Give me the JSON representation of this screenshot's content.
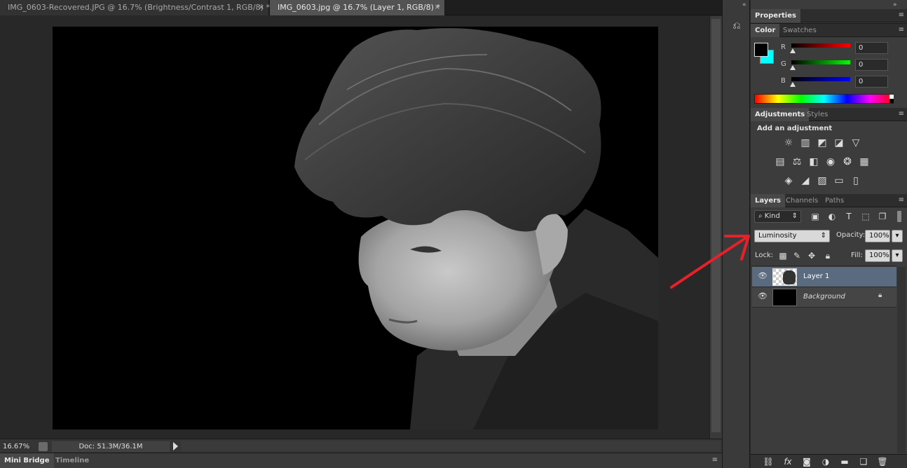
{
  "tabs": [
    {
      "label": "IMG_0603-Recovered.JPG @ 16.7% (Brightness/Contrast 1, RGB/8) *",
      "close": "×",
      "active": false
    },
    {
      "label": "IMG_0603.jpg @ 16.7% (Layer 1, RGB/8) *",
      "close": "×",
      "active": true
    }
  ],
  "status": {
    "zoom": "16.67%",
    "doc_info": "Doc: 51.3M/36.1M"
  },
  "bottom_tabs": [
    "Mini Bridge",
    "Timeline"
  ],
  "properties": {
    "title": "Properties"
  },
  "color_panel": {
    "tabs": [
      "Color",
      "Swatches"
    ],
    "channels": [
      {
        "label": "R",
        "value": "0",
        "color": "#e01010"
      },
      {
        "label": "G",
        "value": "0",
        "color": "#18b818"
      },
      {
        "label": "B",
        "value": "0",
        "color": "#1838e0"
      }
    ],
    "foreground": "#000000",
    "background": "#00ffff"
  },
  "adjustments": {
    "tabs": [
      "Adjustments",
      "Styles"
    ],
    "heading": "Add an adjustment"
  },
  "layers": {
    "tabs": [
      "Layers",
      "Channels",
      "Paths"
    ],
    "filter_kind": "Kind",
    "blend_mode": "Luminosity",
    "opacity_label": "Opacity:",
    "opacity_value": "100%",
    "lock_label": "Lock:",
    "fill_label": "Fill:",
    "fill_value": "100%",
    "items": [
      {
        "name": "Layer 1",
        "selected": true
      },
      {
        "name": "Background",
        "selected": false
      }
    ]
  },
  "annotation": {
    "arrow_color": "#e8202a"
  }
}
